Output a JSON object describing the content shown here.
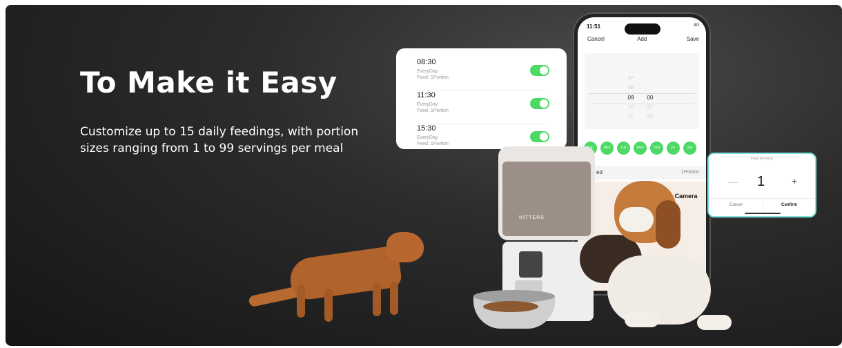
{
  "hero": {
    "title": "To Make it Easy",
    "subtitle": "Customize up to 15 daily feedings, with portion sizes ranging from 1 to 99 servings per meal"
  },
  "schedule": [
    {
      "time": "08:30",
      "repeat": "EveryDay",
      "feed": "Feed: 1Portion",
      "enabled": true
    },
    {
      "time": "11:30",
      "repeat": "EveryDay",
      "feed": "Feed: 1Portion",
      "enabled": true
    },
    {
      "time": "15:30",
      "repeat": "EveryDay",
      "feed": "Feed: 1Portion",
      "enabled": true
    }
  ],
  "phone": {
    "time": "11:51",
    "status": "4G",
    "nav": {
      "cancel": "Cancel",
      "title": "Add",
      "save": "Save"
    },
    "picker": {
      "hours": [
        "07",
        "08",
        "09",
        "10",
        "11"
      ],
      "minutes": [
        "00",
        "01",
        "02"
      ],
      "selected_hour": "09",
      "selected_minute": "00"
    },
    "days": [
      "Sun",
      "Mon",
      "Tue",
      "Wed",
      "Thur",
      "Fri",
      "Sat"
    ],
    "feed_row": {
      "label": "ed",
      "value": "1Portion"
    },
    "promo": "Smart Feeder with Camera"
  },
  "portion_modal": {
    "title": "Feed (Portion)",
    "minus": "—",
    "value": "1",
    "plus": "+",
    "cancel": "Cancel",
    "confirm": "Confirm"
  },
  "feeder": {
    "brand": "NITTERS"
  },
  "colors": {
    "accent_green": "#4cd964",
    "modal_border": "#7ee3e0"
  }
}
